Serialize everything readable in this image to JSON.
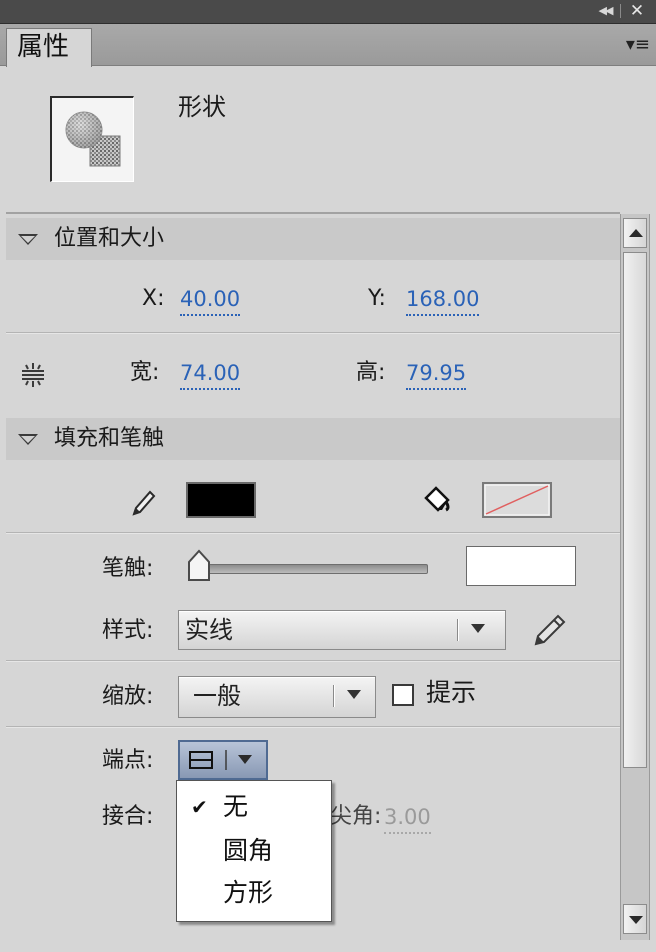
{
  "window": {
    "collapse_glyph": "◀◀",
    "close_glyph": "✕"
  },
  "tab": {
    "label": "属性",
    "menu_glyph": "▾≡"
  },
  "object": {
    "title": "形状",
    "icon": "shape-thumbnail-icon"
  },
  "position_size": {
    "header": "位置和大小",
    "x_label": "X:",
    "x_value": "40.00",
    "y_label": "Y:",
    "y_value": "168.00",
    "width_label": "宽:",
    "width_value": "74.00",
    "height_label": "高:",
    "height_value": "79.95",
    "lock_icon": "chain-link-icon"
  },
  "fill_stroke": {
    "header": "填充和笔触",
    "stroke_color": "#000000",
    "fill_color": "none",
    "stroke_label": "笔触:",
    "stroke_value": "",
    "style_label": "样式:",
    "style_value": "实线",
    "scale_label": "缩放:",
    "scale_value": "一般",
    "hint_label": "提示",
    "hint_checked": false,
    "cap_label": "端点:",
    "join_label": "接合:",
    "miter_label": "尖角:",
    "miter_value": "3.00"
  },
  "cap_menu": {
    "items": [
      {
        "label": "无",
        "checked": true
      },
      {
        "label": "圆角",
        "checked": false
      },
      {
        "label": "方形",
        "checked": false
      }
    ],
    "check_glyph": "✔"
  }
}
